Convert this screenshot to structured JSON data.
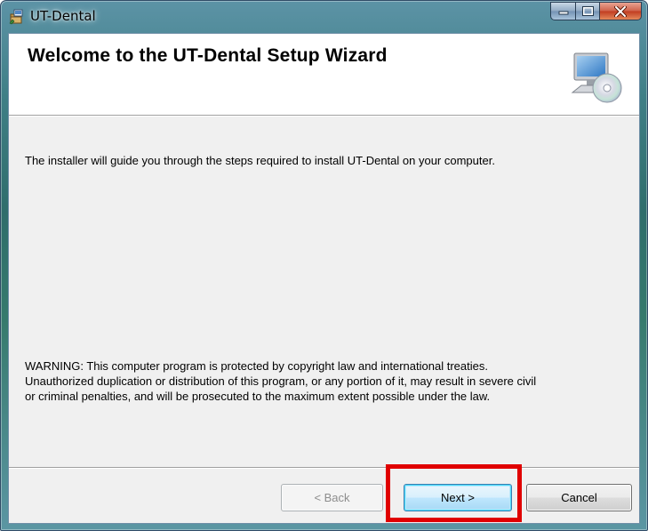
{
  "window": {
    "title": "UT-Dental",
    "controls": {
      "minimize": "minimize",
      "maximize": "maximize",
      "close": "close"
    }
  },
  "banner": {
    "title": "Welcome to the UT-Dental Setup Wizard",
    "icon": "computer-cd-icon"
  },
  "content": {
    "intro": "The installer will guide you through the steps required to install UT-Dental on your computer.",
    "warning_lines": [
      "WARNING: This computer program is protected by copyright law and international treaties.",
      "Unauthorized duplication or distribution of this program, or any portion of it, may result in severe civil",
      "or criminal penalties, and will be prosecuted to the maximum extent possible under the law."
    ]
  },
  "buttons": {
    "back": {
      "label": "< Back",
      "enabled": false
    },
    "next": {
      "label": "Next >",
      "enabled": true,
      "default": true
    },
    "cancel": {
      "label": "Cancel",
      "enabled": true
    }
  },
  "annotation": {
    "color": "#e00000",
    "target": "next-button"
  },
  "colors": {
    "title_glass": "#3f7f86",
    "client_bg": "#f0f0f0",
    "banner_bg": "#ffffff"
  }
}
